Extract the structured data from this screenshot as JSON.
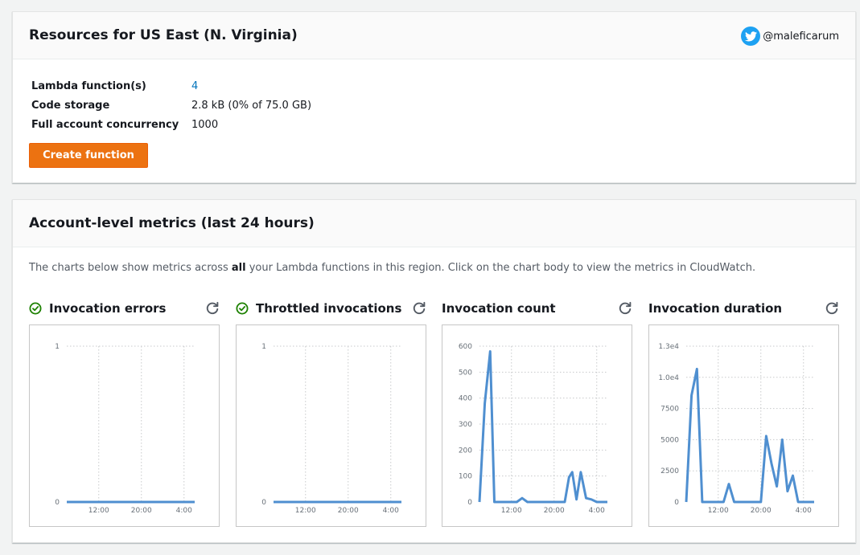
{
  "resources": {
    "title": "Resources for US East (N. Virginia)",
    "twitter_handle": "@maleficarum",
    "rows": [
      {
        "key": "Lambda function(s)",
        "value": "4",
        "link": true
      },
      {
        "key": "Code storage",
        "value": "2.8 kB (0% of 75.0 GB)",
        "link": false
      },
      {
        "key": "Full account concurrency",
        "value": "1000",
        "link": false
      }
    ],
    "create_button": "Create function"
  },
  "metrics": {
    "title": "Account-level metrics (last 24 hours)",
    "desc_before": "The charts below show metrics across ",
    "desc_bold": "all",
    "desc_after": " your Lambda functions in this region. Click on the chart body to view the metrics in CloudWatch."
  },
  "colors": {
    "accent_orange": "#ec7211",
    "link_blue": "#0073bb",
    "status_green": "#1d8102",
    "series_blue": "#4f8fd0"
  },
  "chart_data": [
    {
      "id": "errors",
      "type": "line",
      "title": "Invocation errors",
      "status_icon": "check-circle-icon",
      "ylim": [
        0,
        1
      ],
      "y_ticks": [
        "1",
        "0"
      ],
      "x_ticks": [
        "12:00",
        "20:00",
        "4:00"
      ],
      "x": [
        0,
        24
      ],
      "values": [
        0,
        0
      ]
    },
    {
      "id": "throttles",
      "type": "line",
      "title": "Throttled invocations",
      "status_icon": "check-circle-icon",
      "ylim": [
        0,
        1
      ],
      "y_ticks": [
        "1",
        "0"
      ],
      "x_ticks": [
        "12:00",
        "20:00",
        "4:00"
      ],
      "x": [
        0,
        24
      ],
      "values": [
        0,
        0
      ]
    },
    {
      "id": "invocations",
      "type": "line",
      "title": "Invocation count",
      "status_icon": "",
      "ylim": [
        0,
        600
      ],
      "y_ticks": [
        "600",
        "500",
        "400",
        "300",
        "200",
        "100",
        "0"
      ],
      "x_ticks": [
        "12:00",
        "20:00",
        "4:00"
      ],
      "x": [
        0,
        1,
        2,
        2.8,
        4,
        5,
        6,
        7,
        8,
        9,
        10,
        11,
        12,
        14,
        16,
        16.8,
        17.4,
        18.2,
        19,
        20,
        21,
        22,
        23,
        24
      ],
      "values": [
        0,
        380,
        580,
        0,
        0,
        0,
        0,
        0,
        15,
        0,
        0,
        0,
        0,
        0,
        0,
        95,
        115,
        10,
        115,
        15,
        10,
        0,
        0,
        0
      ]
    },
    {
      "id": "duration",
      "type": "line",
      "title": "Invocation duration",
      "status_icon": "",
      "ylim": [
        0,
        13000
      ],
      "y_ticks": [
        "1.3e4",
        "1.0e4",
        "7500",
        "5000",
        "2500",
        "0"
      ],
      "x_ticks": [
        "12:00",
        "20:00",
        "4:00"
      ],
      "x": [
        0,
        1,
        2,
        3,
        4,
        5,
        6,
        7,
        8,
        9,
        10,
        11,
        12,
        13,
        14,
        15,
        16,
        17,
        18,
        19,
        20,
        21,
        22,
        23,
        24
      ],
      "values": [
        0,
        8900,
        11100,
        0,
        0,
        0,
        0,
        0,
        1500,
        0,
        0,
        0,
        0,
        0,
        0,
        5500,
        3200,
        1300,
        5200,
        900,
        2200,
        0,
        0,
        0,
        0
      ]
    }
  ]
}
